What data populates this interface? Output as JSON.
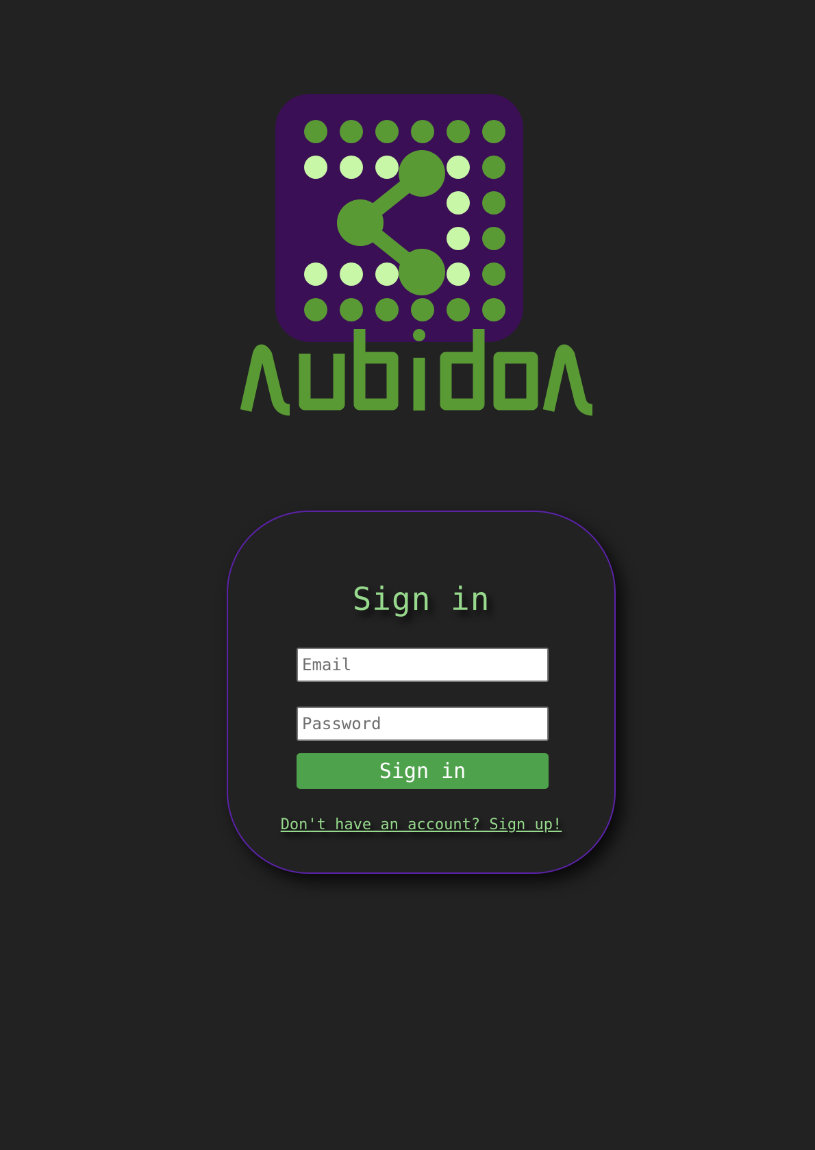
{
  "brand": {
    "logo_name": "subidos",
    "icon": "share-icon",
    "colors": {
      "tile": "#3b0f55",
      "dot_dark": "#5a9a35",
      "dot_light": "#c9f7a8",
      "wordmark": "#5a9a35"
    }
  },
  "signin": {
    "title": "Sign in",
    "email_placeholder": "Email",
    "password_placeholder": "Password",
    "button_label": "Sign in",
    "signup_link": "Don't have an account? Sign up!"
  },
  "colors": {
    "background": "#222222",
    "accent_text": "#97d98d",
    "button": "#4fa24c",
    "card_border": "#5b22a8"
  }
}
